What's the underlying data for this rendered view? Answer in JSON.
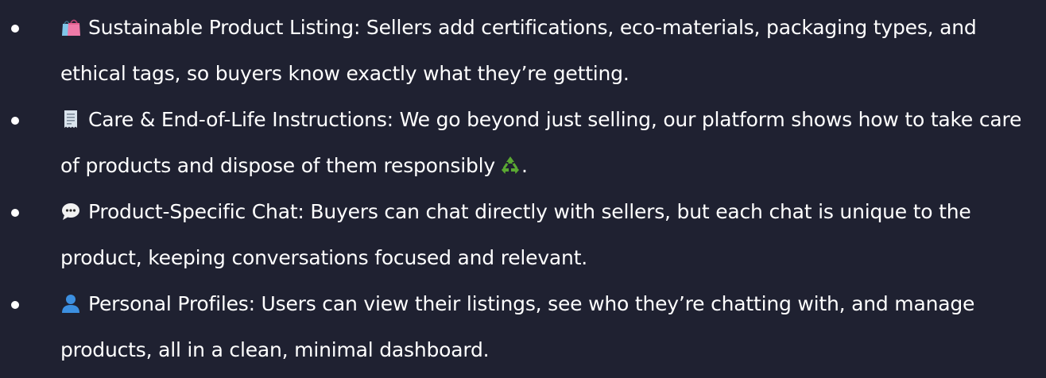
{
  "feature_list": {
    "items": [
      {
        "icon": "shopping-bags-icon",
        "text": "Sustainable Product Listing: Sellers add certifications, eco-materials, packaging types, and ethical tags, so buyers know exactly what they’re getting."
      },
      {
        "icon": "receipt-icon",
        "text": "Care & End-of-Life Instructions: We go beyond just selling, our platform shows how to take care of products and dispose of them responsibly",
        "text_end": ".",
        "inline_icon": "recycle-icon"
      },
      {
        "icon": "speech-bubble-icon",
        "text": "Product-Specific Chat: Buyers can chat directly with sellers, but each chat is unique to the product, keeping conversations focused and relevant."
      },
      {
        "icon": "person-silhouette-icon",
        "text": "Personal Profiles: Users can view their listings, see who they’re chatting with, and manage products, all in a clean, minimal dashboard."
      }
    ]
  },
  "colors": {
    "background": "#1f2131",
    "text": "#ffffff",
    "bags_icon": "#ef7aa8",
    "bags_accent": "#7fc6e8",
    "receipt_icon": "#d9e3ec",
    "recycle_icon": "#5aa832",
    "bubble_icon": "#f2f2f2",
    "person_icon": "#3c8fe0"
  }
}
